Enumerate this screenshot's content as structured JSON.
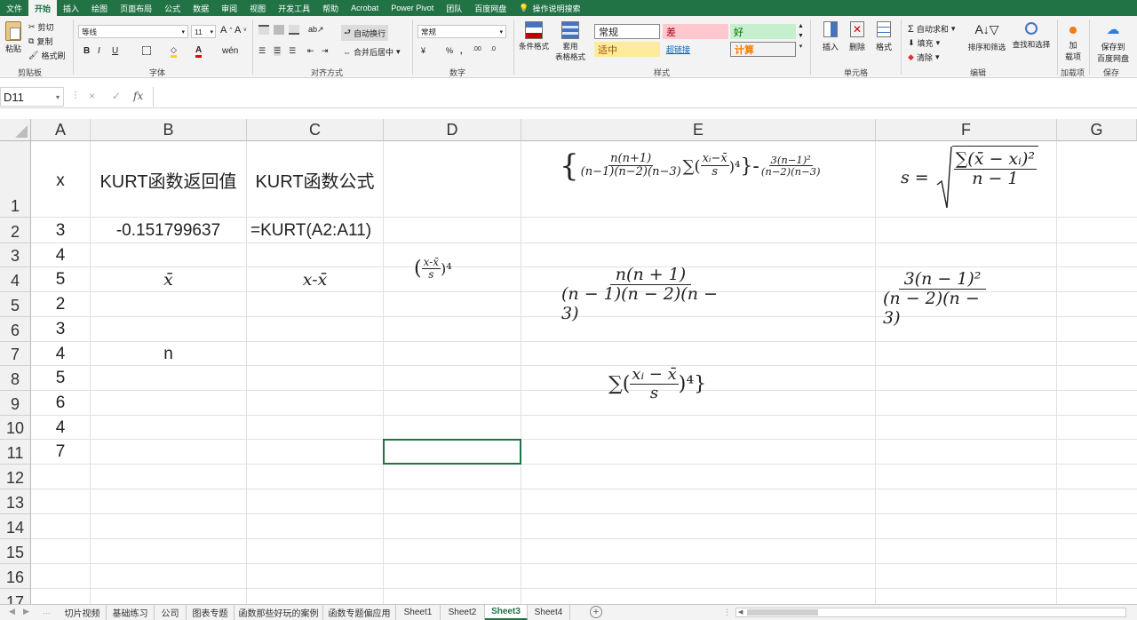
{
  "menu": [
    "文件",
    "开始",
    "插入",
    "绘图",
    "页面布局",
    "公式",
    "数据",
    "审阅",
    "视图",
    "开发工具",
    "帮助",
    "Acrobat",
    "Power Pivot",
    "团队",
    "百度网盘"
  ],
  "menu_active": "开始",
  "tell_me": "操作说明搜索",
  "clipboard": {
    "paste": "粘贴",
    "cut": "剪切",
    "copy": "复制",
    "format_painter": "格式刷",
    "label": "剪贴板"
  },
  "font": {
    "name": "等线",
    "size": "11",
    "label": "字体"
  },
  "alignment": {
    "wrap": "自动换行",
    "merge": "合并后居中",
    "label": "对齐方式"
  },
  "number": {
    "format": "常规",
    "label": "数字"
  },
  "styles": {
    "cond_format": "条件格式",
    "table_format_1": "套用",
    "table_format_2": "表格格式",
    "normal": "常规",
    "bad": "差",
    "good": "好",
    "neutral": "适中",
    "hyperlink": "超链接",
    "calc": "计算",
    "label": "样式"
  },
  "cells": {
    "insert": "插入",
    "delete": "删除",
    "format": "格式",
    "label": "单元格"
  },
  "editing": {
    "autosum": "自动求和",
    "fill": "填充",
    "clear": "清除",
    "sort": "排序和筛选",
    "find": "查找和选择",
    "label": "编辑"
  },
  "addins": {
    "add_1": "加",
    "add_2": "载项",
    "label": "加载项"
  },
  "save": {
    "save_1": "保存到",
    "save_2": "百度网盘",
    "label": "保存"
  },
  "formula_bar": {
    "name_box": "D11",
    "cancel": "×",
    "enter": "✓",
    "fx": "fx",
    "content": ""
  },
  "columns": [
    "A",
    "B",
    "C",
    "D",
    "E",
    "F",
    "G"
  ],
  "rows": [
    "1",
    "2",
    "3",
    "4",
    "5",
    "6",
    "7",
    "8",
    "9",
    "10",
    "11",
    "12",
    "13",
    "14",
    "15",
    "16",
    "17"
  ],
  "cells_data": {
    "A1": "x",
    "B1": "KURT函数返回值",
    "C1": "KURT函数公式",
    "A2": "3",
    "B2": "-0.151799637",
    "C2": "=KURT(A2:A11)",
    "A3": "4",
    "A4": "5",
    "A5": "2",
    "A6": "3",
    "A7": "4",
    "A8": "5",
    "A9": "6",
    "A10": "4",
    "A11": "7",
    "B4": "x̄",
    "C4": "x-x̄",
    "B7": "n"
  },
  "equations": {
    "e1_num": "n(n+1)",
    "e1_den": "(n−1)(n−2)(n−3)",
    "e1_sum": "∑(",
    "e1_inner_num": "xᵢ−x̄",
    "e1_inner_den": "s",
    "e1_pow": ")⁴",
    "e1_minus": "}-",
    "e1_r_num": "3(n−1)²",
    "e1_r_den": "(n−2)(n−3)",
    "e1_open": "{",
    "f1_lhs": "s =",
    "f1_num": "∑(x̄ − xᵢ)²",
    "f1_den": "n − 1",
    "d4_num": "x-x̄",
    "d4_den": "s",
    "d4_open": "(",
    "d4_close": ")⁴",
    "e4_num": "n(n + 1)",
    "e4_den": "(n − 1)(n − 2)(n − 3)",
    "f4_num": "3(n − 1)²",
    "f4_den": "(n − 2)(n − 3)",
    "e8_sum": "∑(",
    "e8_num": "xᵢ − x̄",
    "e8_den": "s",
    "e8_close": ")⁴}"
  },
  "sheets": [
    "切片视频",
    "基础练习",
    "公司",
    "图表专题",
    "函数那些好玩的案例",
    "函数专题偏应用",
    "Sheet1",
    "Sheet2",
    "Sheet3",
    "Sheet4"
  ],
  "active_sheet": "Sheet3",
  "colors": {
    "brand": "#217346",
    "bad_bg": "#ffc7ce",
    "bad_fg": "#9c0006",
    "good_bg": "#c6efce",
    "good_fg": "#006100",
    "neutral_bg": "#ffeb9c",
    "neutral_fg": "#9c5700",
    "calc_bg": "#f2f2f2",
    "calc_fg": "#fa7d00"
  }
}
